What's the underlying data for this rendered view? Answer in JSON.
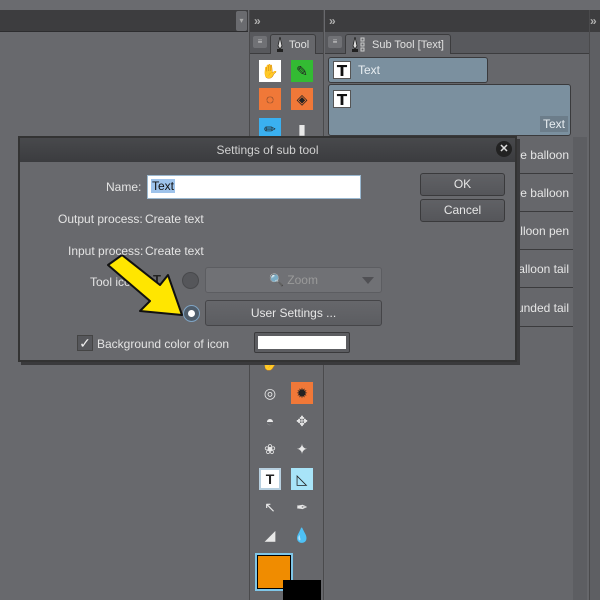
{
  "panels": {
    "tool": {
      "tab_label": "Tool",
      "collapse_glyph": "»"
    },
    "sub_tool": {
      "tab_label": "Sub Tool [Text]",
      "collapse_glyph": "»",
      "items": [
        {
          "label": "Text",
          "selected": true
        },
        {
          "label": "Text",
          "selected": true,
          "detail": true
        },
        {
          "label": "se balloon"
        },
        {
          "label": "ve balloon"
        },
        {
          "label": "alloon pen"
        },
        {
          "label": "Balloon tail"
        },
        {
          "label": "unded tail"
        }
      ]
    },
    "right": {
      "collapse_glyph": "»"
    }
  },
  "tools": [
    {
      "name": "hand",
      "glyph": "✋",
      "bg": "#ffffff"
    },
    {
      "name": "eyedropper",
      "glyph": "✎",
      "bg": "#33bb33"
    },
    {
      "name": "lasso",
      "glyph": "◌",
      "bg": "#f07838"
    },
    {
      "name": "move",
      "glyph": "◈",
      "bg": "#f07838"
    },
    {
      "name": "pen",
      "glyph": "✏",
      "bg": "#3ab0f0"
    },
    {
      "name": "eraser",
      "glyph": "▮",
      "bg": "transparent"
    },
    {
      "name": "blend",
      "glyph": "✋",
      "bg": "transparent"
    },
    {
      "name": "airbrush",
      "glyph": "◎",
      "bg": "transparent"
    },
    {
      "name": "effect-burst",
      "glyph": "✹",
      "bg": "#f07838"
    },
    {
      "name": "fill",
      "glyph": "◓",
      "bg": "transparent"
    },
    {
      "name": "decoration",
      "glyph": "✥",
      "bg": "transparent"
    },
    {
      "name": "flower-brush",
      "glyph": "❀",
      "bg": "transparent"
    },
    {
      "name": "sparkle",
      "glyph": "✦",
      "bg": "transparent"
    },
    {
      "name": "text",
      "glyph": "T",
      "bg": "#ffffff"
    },
    {
      "name": "ruler",
      "glyph": "◺",
      "bg": "#a8e4f8"
    },
    {
      "name": "operation",
      "glyph": "↖",
      "bg": "transparent"
    },
    {
      "name": "pen-nib",
      "glyph": "✒",
      "bg": "transparent"
    },
    {
      "name": "gradient",
      "glyph": "◢",
      "bg": "transparent"
    },
    {
      "name": "ink",
      "glyph": "💧",
      "bg": "transparent"
    }
  ],
  "colors": {
    "main": "#f08c00",
    "sub": "#000000",
    "accent": "#7b909f"
  },
  "dialog": {
    "title": "Settings of sub tool",
    "name_label": "Name:",
    "name_value": "Text",
    "output_label": "Output process:",
    "output_value": "Create text",
    "input_label": "Input process:",
    "input_value": "Create text",
    "tool_icon_label": "Tool icon:",
    "zoom_option": "Zoom",
    "user_settings_label": "User Settings ...",
    "bg_color_label": "Background color of icon",
    "bg_color_checked": true,
    "bg_color_value": "#ffffff",
    "ok_label": "OK",
    "cancel_label": "Cancel",
    "close_glyph": "✕"
  }
}
